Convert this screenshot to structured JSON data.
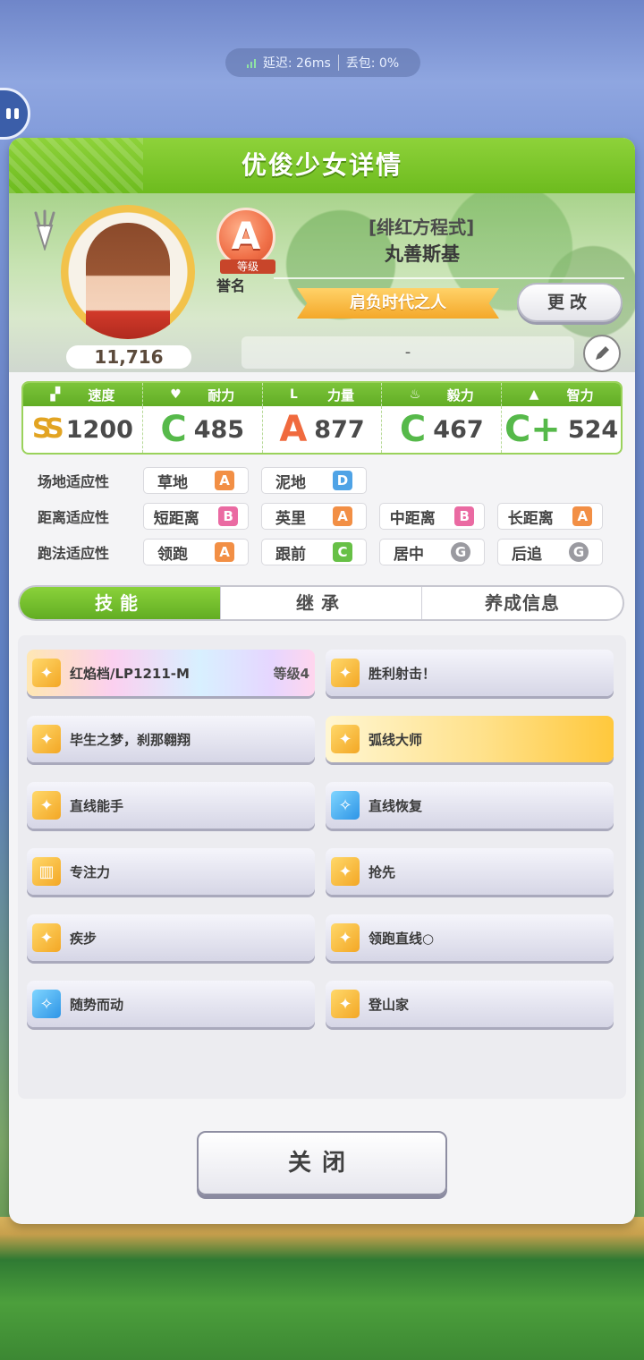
{
  "status": {
    "network": "延迟: 26ms",
    "packet_loss": "丢包: 0%"
  },
  "dialog": {
    "title": "优俊少女详情",
    "character": {
      "epithet": "[绯红方程式]",
      "name": "丸善斯基",
      "fans": "11,716",
      "rank": "A",
      "rank_label": "等级",
      "rank_name": "誉名",
      "title_banner": "肩负时代之人",
      "change_label": "更改",
      "comment": "-"
    },
    "stats": [
      {
        "label": "速度",
        "grade": "SS",
        "value": "1200",
        "icon": "shoe-icon"
      },
      {
        "label": "耐力",
        "grade": "C",
        "value": "485",
        "icon": "heart-icon"
      },
      {
        "label": "力量",
        "grade": "A",
        "value": "877",
        "icon": "muscle-icon"
      },
      {
        "label": "毅力",
        "grade": "C",
        "value": "467",
        "icon": "flame-icon"
      },
      {
        "label": "智力",
        "grade": "C+",
        "value": "524",
        "icon": "graduation-cap-icon"
      }
    ],
    "aptitude": {
      "track": {
        "label": "场地适应性",
        "items": [
          {
            "name": "草地",
            "grade": "A"
          },
          {
            "name": "泥地",
            "grade": "D"
          }
        ]
      },
      "distance": {
        "label": "距离适应性",
        "items": [
          {
            "name": "短距离",
            "grade": "B"
          },
          {
            "name": "英里",
            "grade": "A"
          },
          {
            "name": "中距离",
            "grade": "B"
          },
          {
            "name": "长距离",
            "grade": "A"
          }
        ]
      },
      "strategy": {
        "label": "跑法适应性",
        "items": [
          {
            "name": "领跑",
            "grade": "A"
          },
          {
            "name": "跟前",
            "grade": "C"
          },
          {
            "name": "居中",
            "grade": "G"
          },
          {
            "name": "后追",
            "grade": "G"
          }
        ]
      }
    },
    "tabs": [
      {
        "label": "技能",
        "active": true
      },
      {
        "label": "继承",
        "active": false
      },
      {
        "label": "养成信息",
        "active": false
      }
    ],
    "skills": [
      {
        "name": "红焰档/LP1211-M",
        "level": "等级4",
        "style": "rainbow",
        "icon": "speed-skill-icon"
      },
      {
        "name": "胜利射击！",
        "style": "normal",
        "icon": "speed-skill-icon"
      },
      {
        "name": "毕生之梦，刹那翱翔",
        "style": "normal",
        "icon": "speed-skill-icon"
      },
      {
        "name": "弧线大师",
        "style": "gold",
        "icon": "speed-skill-icon"
      },
      {
        "name": "直线能手",
        "style": "normal",
        "icon": "speed-skill-icon"
      },
      {
        "name": "直线恢复",
        "style": "normal",
        "icon": "recovery-skill-icon"
      },
      {
        "name": "专注力",
        "style": "normal",
        "icon": "gate-skill-icon"
      },
      {
        "name": "抢先",
        "style": "normal",
        "icon": "speed-skill-icon"
      },
      {
        "name": "疾步",
        "style": "normal",
        "icon": "speed-skill-icon"
      },
      {
        "name": "领跑直线○",
        "style": "normal",
        "icon": "speed-skill-icon"
      },
      {
        "name": "随势而动",
        "style": "normal",
        "icon": "recovery-skill-icon"
      },
      {
        "name": "登山家",
        "style": "normal",
        "icon": "speed-skill-icon"
      }
    ],
    "close_label": "关闭"
  }
}
